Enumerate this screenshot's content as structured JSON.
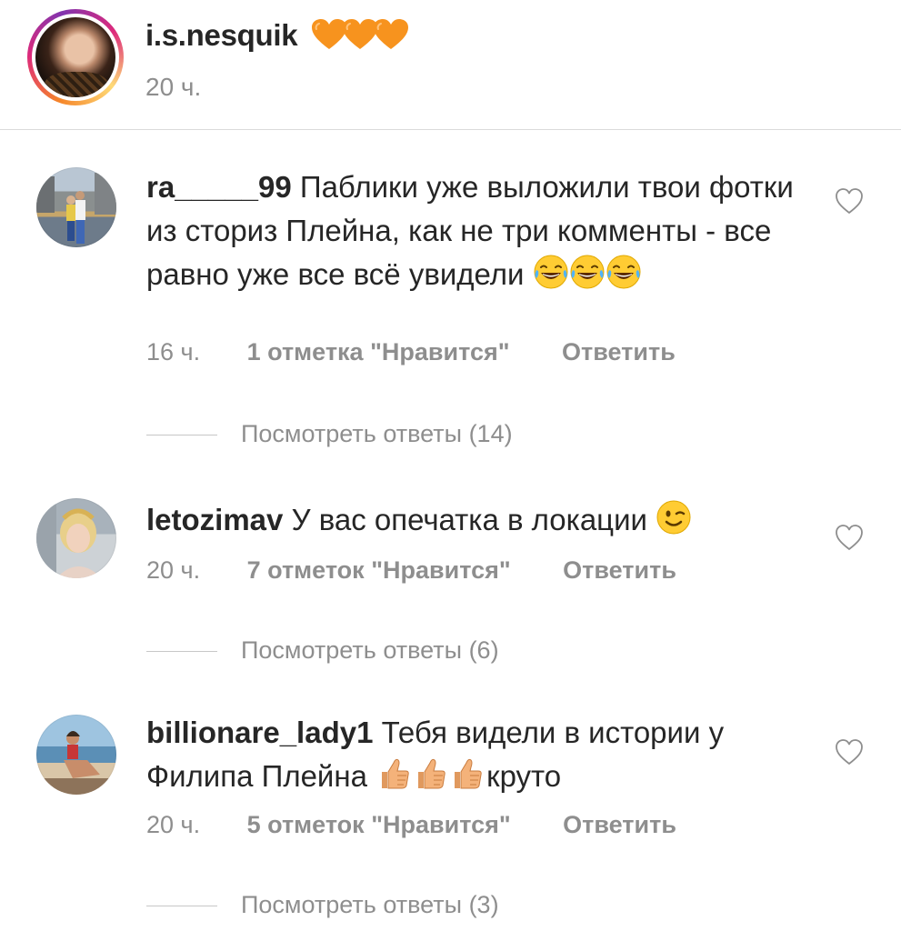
{
  "post": {
    "username": "i.s.nesquik",
    "time": "20 ч.",
    "emoji": [
      "orange-heart",
      "orange-heart",
      "orange-heart"
    ]
  },
  "comments": [
    {
      "username": "ra_____99",
      "text": "Паблики уже выложили твои фотки из сториз Плейна, как не три комменты - все равно уже все всё увидели",
      "emoji": [
        "face-with-tears-of-joy",
        "face-with-tears-of-joy",
        "face-with-tears-of-joy"
      ],
      "time": "16 ч.",
      "likes": "1 отметка \"Нравится\"",
      "reply": "Ответить",
      "view_replies": "Посмотреть ответы (14)"
    },
    {
      "username": "letozimav",
      "text": "У вас опечатка в локации",
      "emoji": [
        "winking-face"
      ],
      "time": "20 ч.",
      "likes": "7 отметок \"Нравится\"",
      "reply": "Ответить",
      "view_replies": "Посмотреть ответы (6)"
    },
    {
      "username": "billionare_lady1",
      "text_before": "Тебя видели в истории у Филипа Плейна",
      "emoji": [
        "thumbs-up",
        "thumbs-up",
        "thumbs-up"
      ],
      "text_after": "круто",
      "time": "20 ч.",
      "likes": "5 отметок \"Нравится\"",
      "reply": "Ответить",
      "view_replies": "Посмотреть ответы (3)"
    }
  ]
}
